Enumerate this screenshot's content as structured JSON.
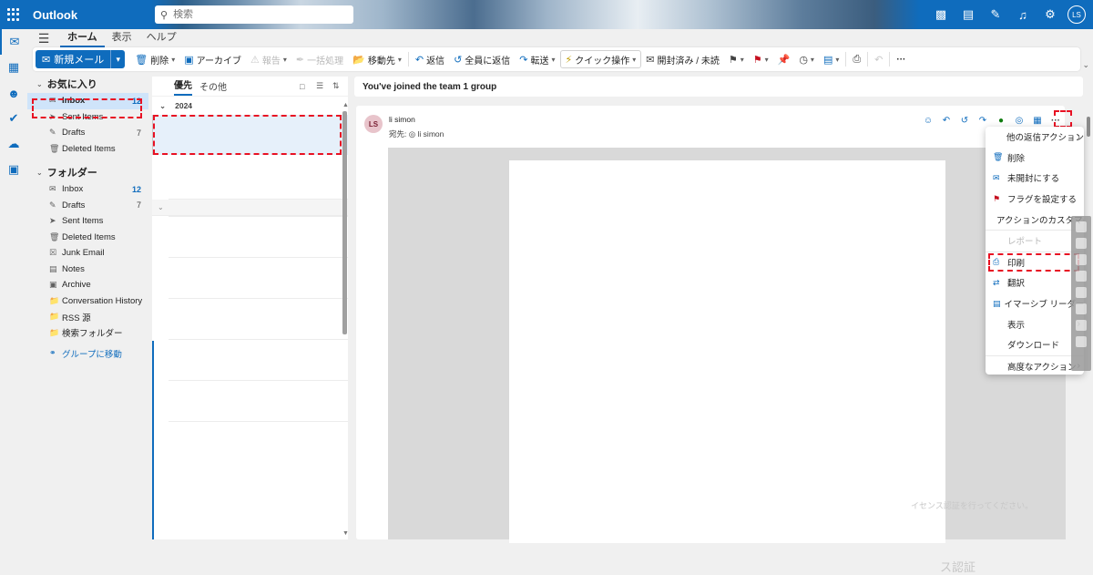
{
  "app": {
    "name": "Outlook",
    "accent": "#0f6cbd"
  },
  "search": {
    "placeholder": "検索"
  },
  "top_icons": [
    "meet-now-icon",
    "teams-icon",
    "notes-icon",
    "bell-icon",
    "gear-icon"
  ],
  "user": {
    "initials": "LS"
  },
  "ribbon_tabs": [
    "ホーム",
    "表示",
    "ヘルプ"
  ],
  "ribbon": {
    "new_mail": "新規メール",
    "delete": "削除",
    "archive": "アーカイブ",
    "report": "報告",
    "sweep": "一括処理",
    "move": "移動先",
    "reply": "返信",
    "reply_all": "全員に返信",
    "forward": "転送",
    "quick_steps": "クイック操作",
    "read_unread": "開封済み / 未読"
  },
  "favorites": {
    "title": "お気に入り",
    "items": [
      {
        "label": "Inbox",
        "count": "12"
      },
      {
        "label": "Sent Items",
        "count": ""
      },
      {
        "label": "Drafts",
        "count": "7"
      },
      {
        "label": "Deleted Items",
        "count": ""
      }
    ]
  },
  "folders": {
    "title": "フォルダー",
    "items": [
      {
        "label": "Inbox",
        "count": "12"
      },
      {
        "label": "Drafts",
        "count": "7"
      },
      {
        "label": "Sent Items",
        "count": ""
      },
      {
        "label": "Deleted Items",
        "count": ""
      },
      {
        "label": "Junk Email",
        "count": ""
      },
      {
        "label": "Notes",
        "count": ""
      },
      {
        "label": "Archive",
        "count": ""
      },
      {
        "label": "Conversation History",
        "count": ""
      },
      {
        "label": "RSS 源",
        "count": ""
      },
      {
        "label": "検索フォルダー",
        "count": ""
      }
    ],
    "group_link": "グループに移動"
  },
  "message_list": {
    "tabs": [
      "優先",
      "その他"
    ],
    "group_year": "2024"
  },
  "reading": {
    "subject": "You've joined the team 1 group",
    "sender": "li simon",
    "avatar": "LS",
    "to_label": "宛先:",
    "to_name": "li simon"
  },
  "more_menu": {
    "items": [
      {
        "label": "他の返信アクション",
        "icon": "",
        "submenu": true,
        "disabled": false
      },
      {
        "label": "削除",
        "icon": "trash-icon",
        "submenu": false,
        "disabled": false
      },
      {
        "label": "未開封にする",
        "icon": "envelope-icon",
        "submenu": false,
        "disabled": false
      },
      {
        "label": "フラグを設定する",
        "icon": "flag-icon",
        "submenu": false,
        "disabled": false
      },
      {
        "label": "アクションのカスタマイズ",
        "icon": "",
        "submenu": false,
        "disabled": false
      },
      {
        "label": "レポート",
        "icon": "",
        "submenu": false,
        "disabled": true
      },
      {
        "label": "印刷",
        "icon": "printer-icon",
        "submenu": false,
        "disabled": false
      },
      {
        "label": "翻訳",
        "icon": "translate-icon",
        "submenu": false,
        "disabled": false
      },
      {
        "label": "イマーシブ リーダーで表示",
        "icon": "immersive-reader-icon",
        "submenu": false,
        "disabled": false
      },
      {
        "label": "表示",
        "icon": "",
        "submenu": true,
        "disabled": false
      },
      {
        "label": "ダウンロード",
        "icon": "",
        "submenu": false,
        "disabled": false
      },
      {
        "label": "高度なアクション",
        "icon": "",
        "submenu": true,
        "disabled": false
      }
    ]
  },
  "watermark": {
    "line1": "ス認証",
    "line2": "イセンス認証を行ってください。"
  }
}
